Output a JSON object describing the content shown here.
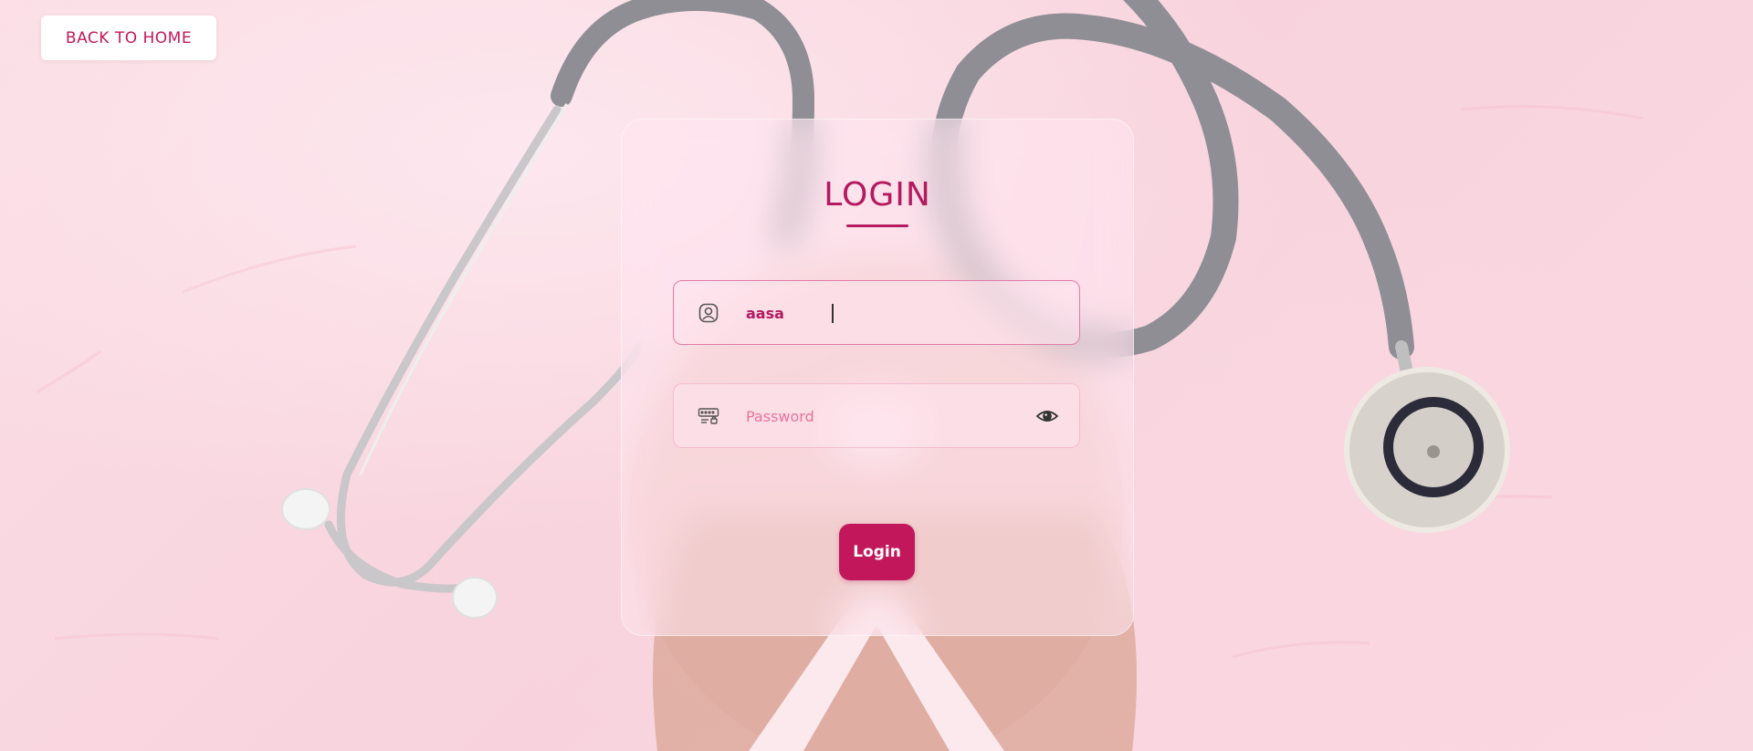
{
  "header": {
    "back_label": "BACK TO HOME"
  },
  "login_form": {
    "title": "LOGIN",
    "username": {
      "value": "aasa",
      "icon": "user-icon"
    },
    "password": {
      "value": "",
      "placeholder": "Password",
      "icon": "keyboard-icon",
      "toggle_icon": "eye-icon"
    },
    "submit_label": "Login"
  },
  "colors": {
    "accent": "#c2185b",
    "background": "#fad9e2",
    "button_bg": "#ffffff"
  }
}
